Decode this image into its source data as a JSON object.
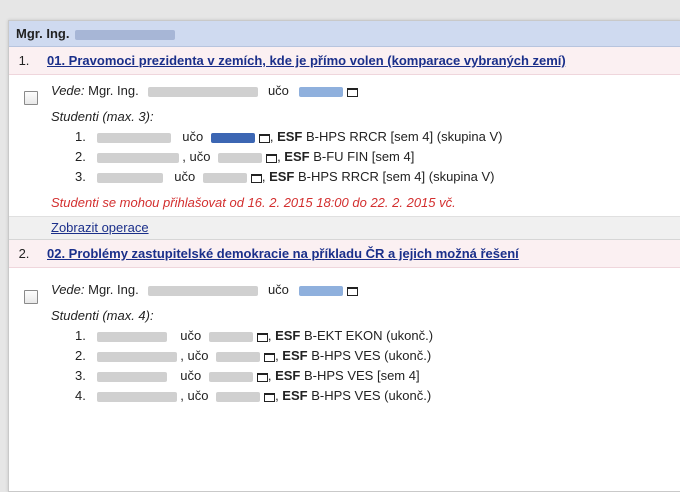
{
  "supervisor": {
    "title": "Mgr. Ing."
  },
  "topics": [
    {
      "number": "1.",
      "title": "01. Pravomoci prezidenta v zemích, kde je přímo volen (komparace vybraných zemí)",
      "lead_label": "Vede:",
      "lead_name": "Mgr. Ing.",
      "uco_label": "učo",
      "students_title": "Studenti (max. 3):",
      "students": [
        {
          "idx": "1.",
          "uco": "učo",
          "faculty": "ESF",
          "program": "B-HPS RRCR [sem 4] (skupina V)"
        },
        {
          "idx": "2.",
          "uco": ", učo",
          "faculty": "ESF",
          "program": "B-FU FIN [sem 4]"
        },
        {
          "idx": "3.",
          "uco": "učo",
          "faculty": "ESF",
          "program": "B-HPS RRCR [sem 4] (skupina V)"
        }
      ],
      "notice": "Studenti se mohou přihlašovat od 16. 2. 2015 18:00 do 22. 2. 2015 vč.",
      "ops": "Zobrazit operace"
    },
    {
      "number": "2.",
      "title": "02. Problémy zastupitelské demokracie na příkladu ČR a jejich možná řešení",
      "lead_label": "Vede:",
      "lead_name": "Mgr. Ing.",
      "uco_label": "učo",
      "students_title": "Studenti (max. 4):",
      "students": [
        {
          "idx": "1.",
          "uco": "učo",
          "faculty": "ESF",
          "program": "B-EKT EKON (ukonč.)"
        },
        {
          "idx": "2.",
          "uco": ", učo",
          "faculty": "ESF",
          "program": "B-HPS VES (ukonč.)"
        },
        {
          "idx": "3.",
          "uco": "učo",
          "faculty": "ESF",
          "program": "B-HPS VES [sem 4]"
        },
        {
          "idx": "4.",
          "uco": ", učo",
          "faculty": "ESF",
          "program": "B-HPS VES (ukonč.)"
        }
      ]
    }
  ],
  "icons": {
    "mail": "mail-icon",
    "checkbox": "checkbox"
  },
  "colors": {
    "header_bg": "#cfdaf0",
    "topic_bg": "#fbf0f2",
    "link": "#1a2f8a",
    "notice": "#d32f2f"
  }
}
